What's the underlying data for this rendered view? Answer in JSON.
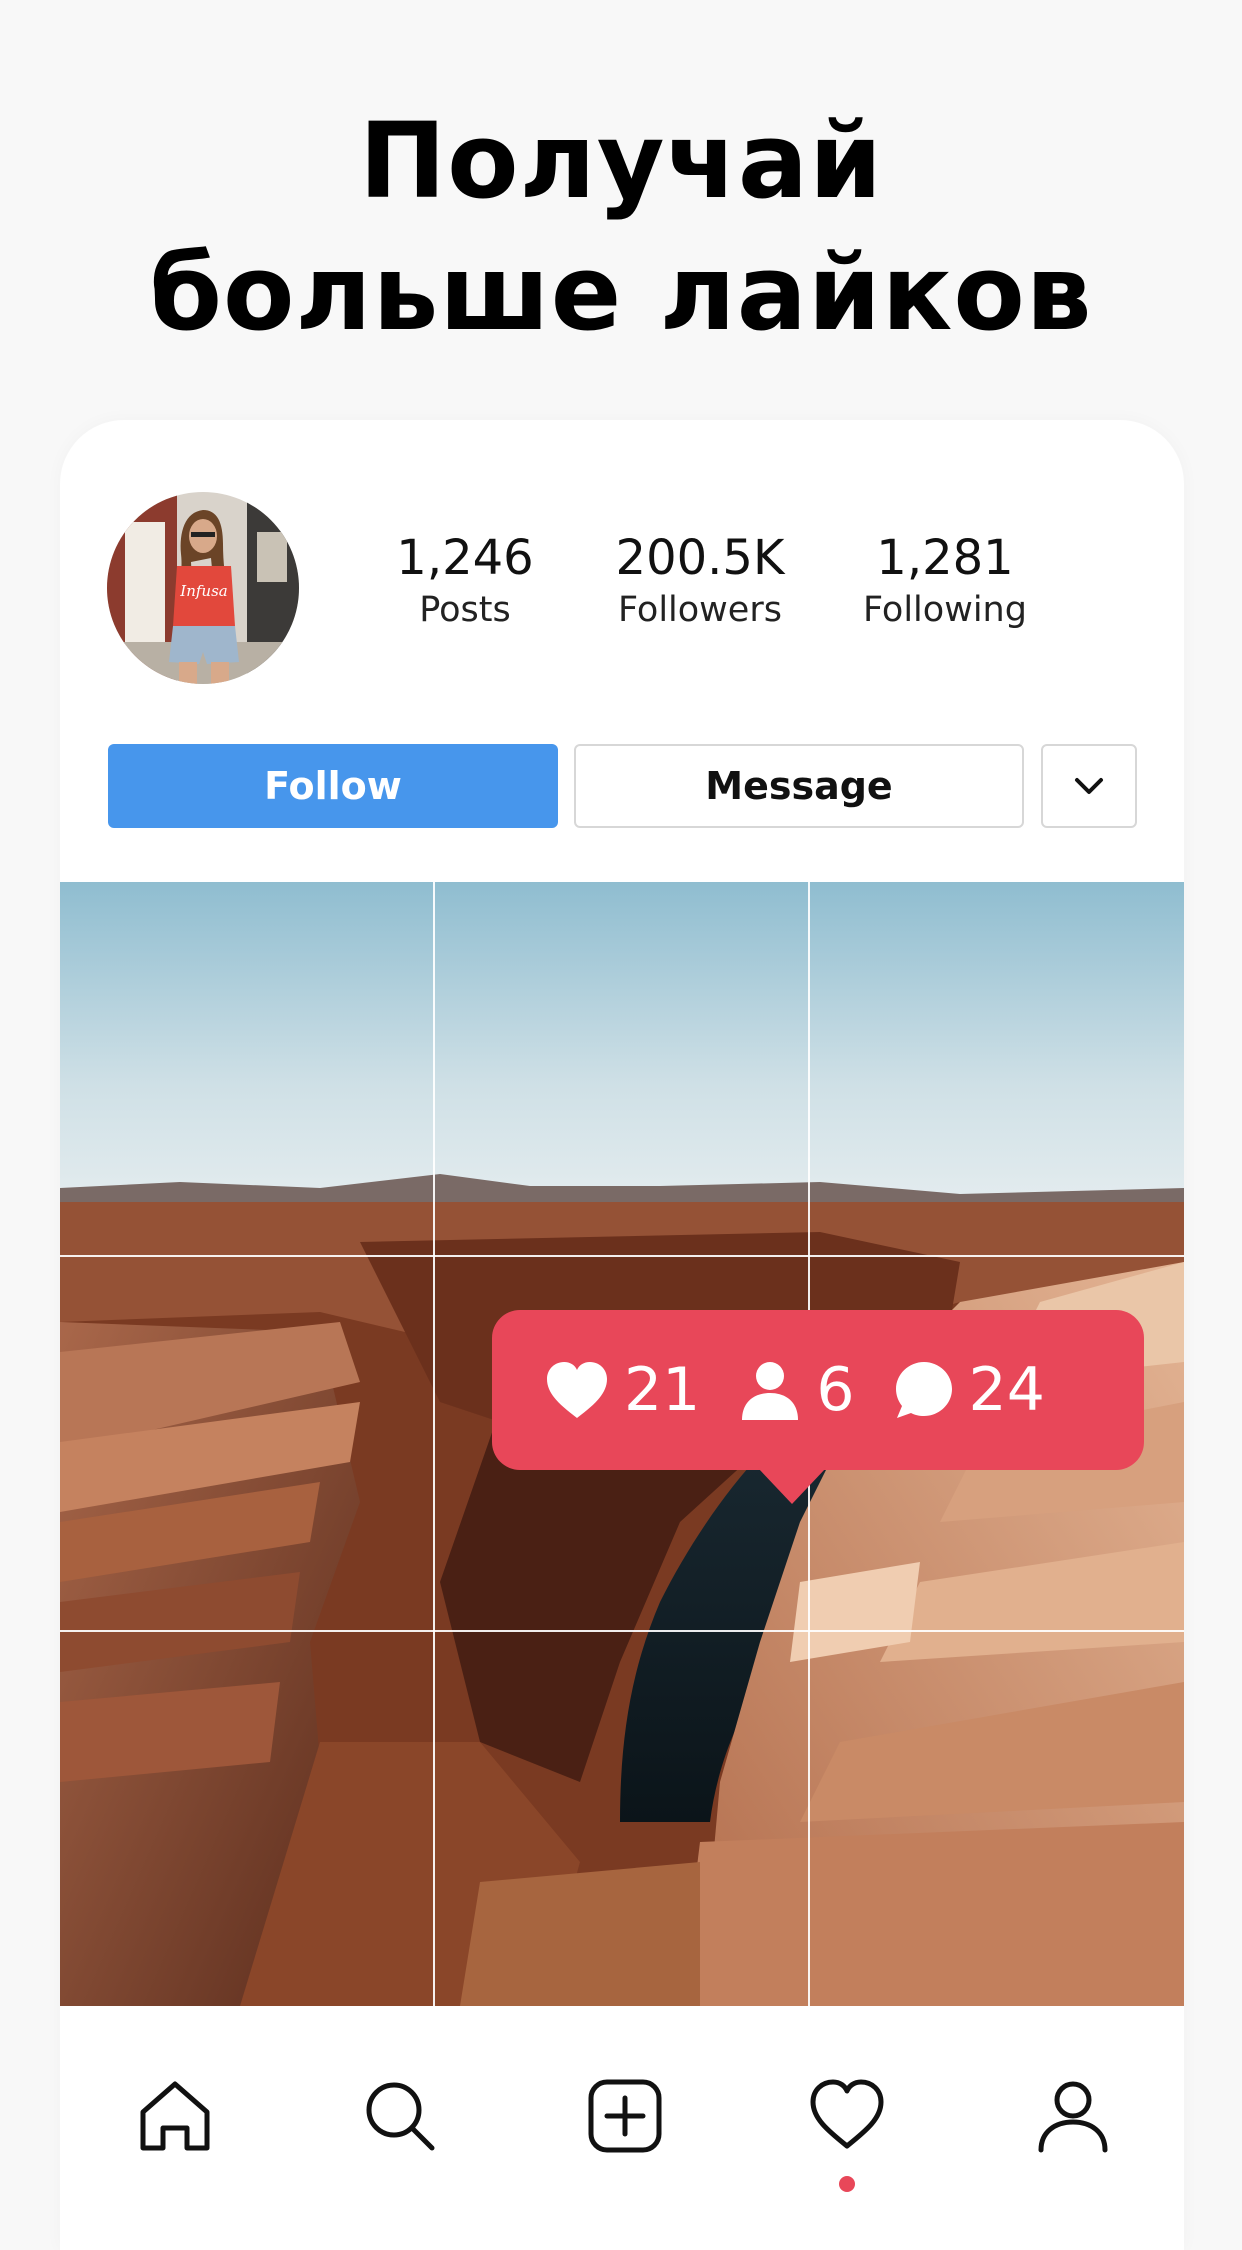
{
  "headline": {
    "line1": "Получай",
    "line2": "больше лайков"
  },
  "profile": {
    "avatar_shirt_text": "Infusa",
    "stats": [
      {
        "value": "1,246",
        "label": "Posts"
      },
      {
        "value": "200.5K",
        "label": "Followers"
      },
      {
        "value": "1,281",
        "label": "Following"
      }
    ]
  },
  "actions": {
    "follow_label": "Follow",
    "message_label": "Message",
    "more_icon": "chevron-down-icon"
  },
  "notification": {
    "likes": "21",
    "followers": "6",
    "comments": "24"
  },
  "tabbar": {
    "items": [
      "home-icon",
      "search-icon",
      "add-post-icon",
      "activity-heart-icon",
      "profile-icon"
    ],
    "active": "activity-heart-icon"
  },
  "colors": {
    "follow_button": "#4796ec",
    "notification": "#e84759"
  }
}
